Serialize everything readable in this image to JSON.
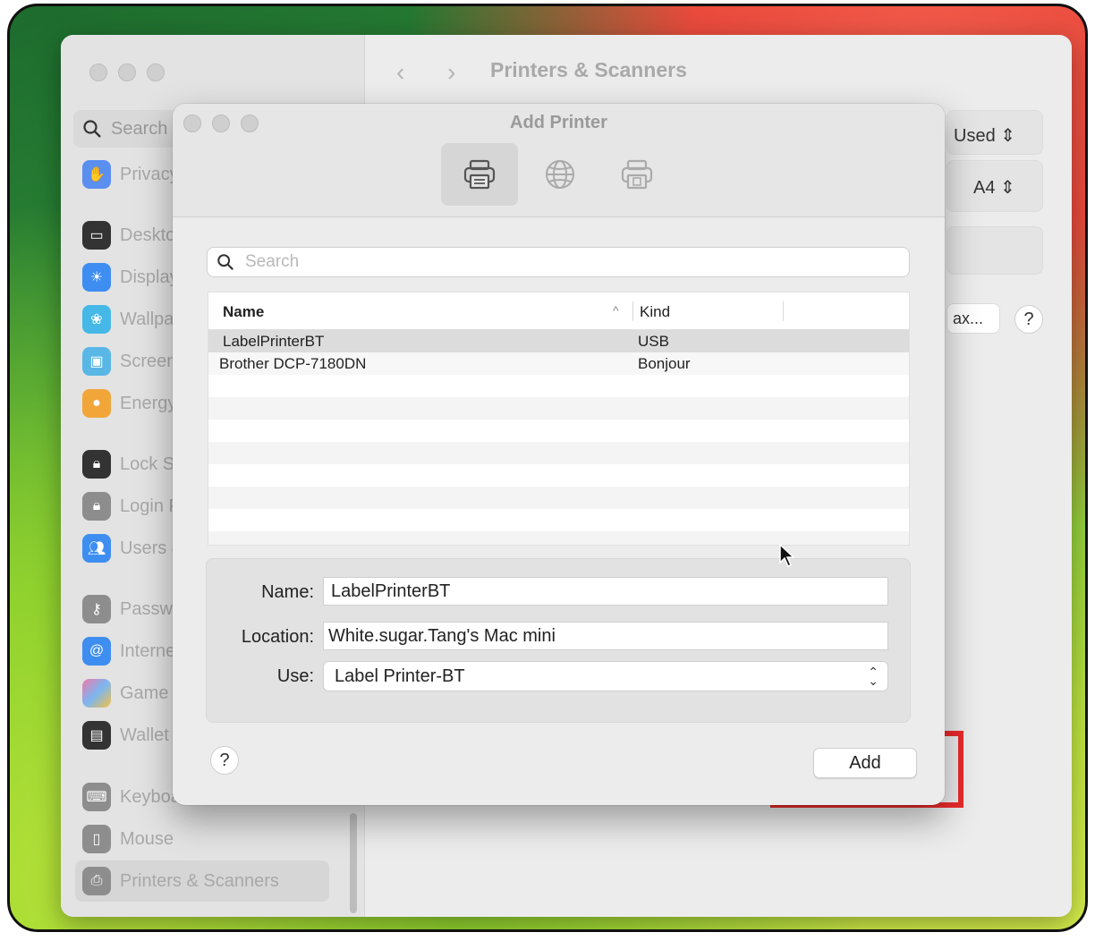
{
  "settings_window": {
    "title": "Printers & Scanners",
    "search_placeholder": "Search",
    "sidebar_items": [
      {
        "label": "Privacy",
        "icon": "hand-icon",
        "color": "#5a8ff0"
      },
      {
        "label": "Deskto",
        "icon": "desktop-icon",
        "color": "#333333"
      },
      {
        "label": "Display",
        "icon": "sun-icon",
        "color": "#3d8ef0"
      },
      {
        "label": "Wallpa",
        "icon": "flower-icon",
        "color": "#45b8e8"
      },
      {
        "label": "Screen",
        "icon": "screensaver-icon",
        "color": "#59b7e6"
      },
      {
        "label": "Energy",
        "icon": "bulb-icon",
        "color": "#f2a63a"
      },
      {
        "label": "Lock S",
        "icon": "lock-icon",
        "color": "#333333"
      },
      {
        "label": "Login P",
        "icon": "lock-icon",
        "color": "#8d8d8d"
      },
      {
        "label": "Users &",
        "icon": "users-icon",
        "color": "#3d8ef0"
      },
      {
        "label": "Passwo",
        "icon": "key-icon",
        "color": "#8d8d8d"
      },
      {
        "label": "Interne",
        "icon": "at-icon",
        "color": "#3d8ef0"
      },
      {
        "label": "Game C",
        "icon": "game-center-icon",
        "color": "#e66ea8"
      },
      {
        "label": "Wallet &",
        "icon": "wallet-icon",
        "color": "#333333"
      },
      {
        "label": "Keyboa",
        "icon": "keyboard-icon",
        "color": "#8d8d8d"
      },
      {
        "label": "Mouse",
        "icon": "mouse-icon",
        "color": "#8d8d8d"
      },
      {
        "label": "Printers & Scanners",
        "icon": "printer-icon",
        "color": "#8d8d8d"
      }
    ],
    "right_fragments": {
      "used": "Used",
      "paper": "A4",
      "fax": "ax..."
    }
  },
  "dialog": {
    "title": "Add Printer",
    "toolbar": [
      {
        "name": "default-printer",
        "icon": "printer-icon"
      },
      {
        "name": "ip-printer",
        "icon": "globe-icon"
      },
      {
        "name": "windows-printer",
        "icon": "windows-printer-icon"
      }
    ],
    "search_placeholder": "Search",
    "table": {
      "headers": [
        "Name",
        "Kind"
      ],
      "rows": [
        {
          "name": "LabelPrinterBT",
          "kind": "USB"
        },
        {
          "name": "Brother DCP-7180DN",
          "kind": "Bonjour"
        }
      ]
    },
    "form": {
      "name_label": "Name:",
      "name_value": "LabelPrinterBT",
      "location_label": "Location:",
      "location_value": "White.sugar.Tang's Mac mini",
      "use_label": "Use:",
      "use_value": "Label Printer-BT"
    },
    "help": "?",
    "add_button": "Add"
  },
  "colors": {
    "highlight": "#ea2b2b"
  }
}
